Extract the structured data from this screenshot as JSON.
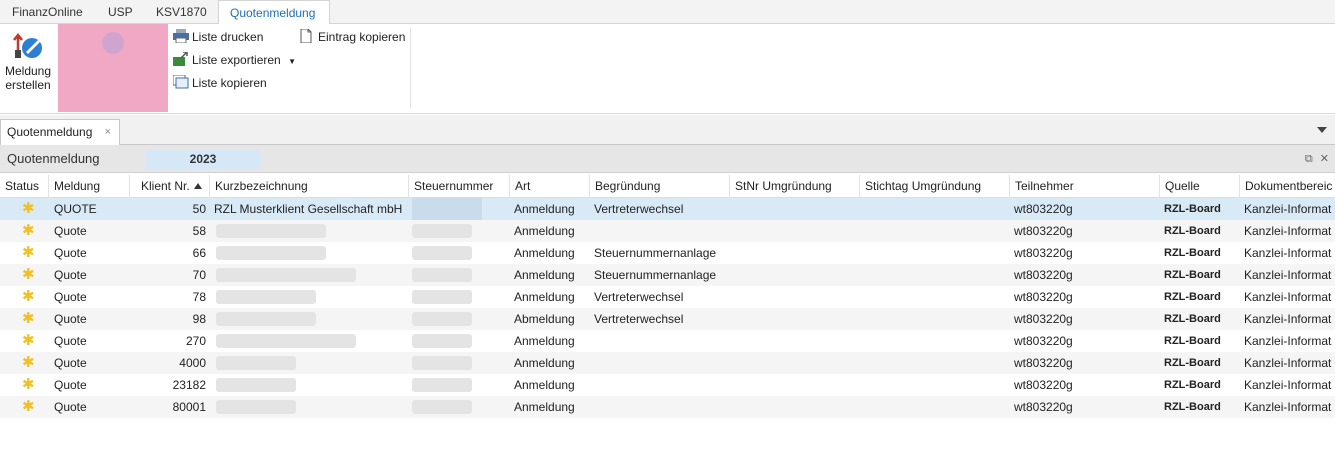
{
  "ribbon_tabs": [
    "FinanzOnline",
    "USP",
    "KSV1870",
    "Quotenmeldung"
  ],
  "ribbon": {
    "meldung_erstellen_1": "Meldung",
    "meldung_erstellen_2": "erstellen",
    "liste_drucken": "Liste drucken",
    "liste_exportieren": "Liste exportieren",
    "liste_kopieren": "Liste kopieren",
    "eintrag_kopieren": "Eintrag kopieren"
  },
  "doc_tab": {
    "label": "Quotenmeldung",
    "close": "×"
  },
  "panel": {
    "title": "Quotenmeldung",
    "year": "2023"
  },
  "columns": [
    "Status",
    "Meldung",
    "Klient Nr.",
    "Kurzbezeichnung",
    "Steuernummer",
    "Art",
    "Begründung",
    "StNr Umgründung",
    "Stichtag Umgründung",
    "Teilnehmer",
    "Quelle",
    "Dokumentbereic"
  ],
  "rows": [
    {
      "status": "✱",
      "meldung": "QUOTE",
      "klient": "50",
      "kurz": "RZL Musterklient Gesellschaft mbH",
      "art": "Anmeldung",
      "begr": "Vertreterwechsel",
      "teil": "wt803220g",
      "quelle": "RZL-Board",
      "dok": "Kanzlei-Informat"
    },
    {
      "status": "✱",
      "meldung": "Quote",
      "klient": "58",
      "kurz": "",
      "art": "Anmeldung",
      "begr": "",
      "teil": "wt803220g",
      "quelle": "RZL-Board",
      "dok": "Kanzlei-Informat"
    },
    {
      "status": "✱",
      "meldung": "Quote",
      "klient": "66",
      "kurz": "",
      "art": "Anmeldung",
      "begr": "Steuernummernanlage",
      "teil": "wt803220g",
      "quelle": "RZL-Board",
      "dok": "Kanzlei-Informat"
    },
    {
      "status": "✱",
      "meldung": "Quote",
      "klient": "70",
      "kurz": "",
      "art": "Anmeldung",
      "begr": "Steuernummernanlage",
      "teil": "wt803220g",
      "quelle": "RZL-Board",
      "dok": "Kanzlei-Informat"
    },
    {
      "status": "✱",
      "meldung": "Quote",
      "klient": "78",
      "kurz": "",
      "art": "Anmeldung",
      "begr": "Vertreterwechsel",
      "teil": "wt803220g",
      "quelle": "RZL-Board",
      "dok": "Kanzlei-Informat"
    },
    {
      "status": "✱",
      "meldung": "Quote",
      "klient": "98",
      "kurz": "",
      "art": "Abmeldung",
      "begr": "Vertreterwechsel",
      "teil": "wt803220g",
      "quelle": "RZL-Board",
      "dok": "Kanzlei-Informat"
    },
    {
      "status": "✱",
      "meldung": "Quote",
      "klient": "270",
      "kurz": "",
      "art": "Anmeldung",
      "begr": "",
      "teil": "wt803220g",
      "quelle": "RZL-Board",
      "dok": "Kanzlei-Informat"
    },
    {
      "status": "✱",
      "meldung": "Quote",
      "klient": "4000",
      "kurz": "",
      "art": "Anmeldung",
      "begr": "",
      "teil": "wt803220g",
      "quelle": "RZL-Board",
      "dok": "Kanzlei-Informat"
    },
    {
      "status": "✱",
      "meldung": "Quote",
      "klient": "23182",
      "kurz": "",
      "art": "Anmeldung",
      "begr": "",
      "teil": "wt803220g",
      "quelle": "RZL-Board",
      "dok": "Kanzlei-Informat"
    },
    {
      "status": "✱",
      "meldung": "Quote",
      "klient": "80001",
      "kurz": "",
      "art": "Anmeldung",
      "begr": "",
      "teil": "wt803220g",
      "quelle": "RZL-Board",
      "dok": "Kanzlei-Informat"
    }
  ]
}
